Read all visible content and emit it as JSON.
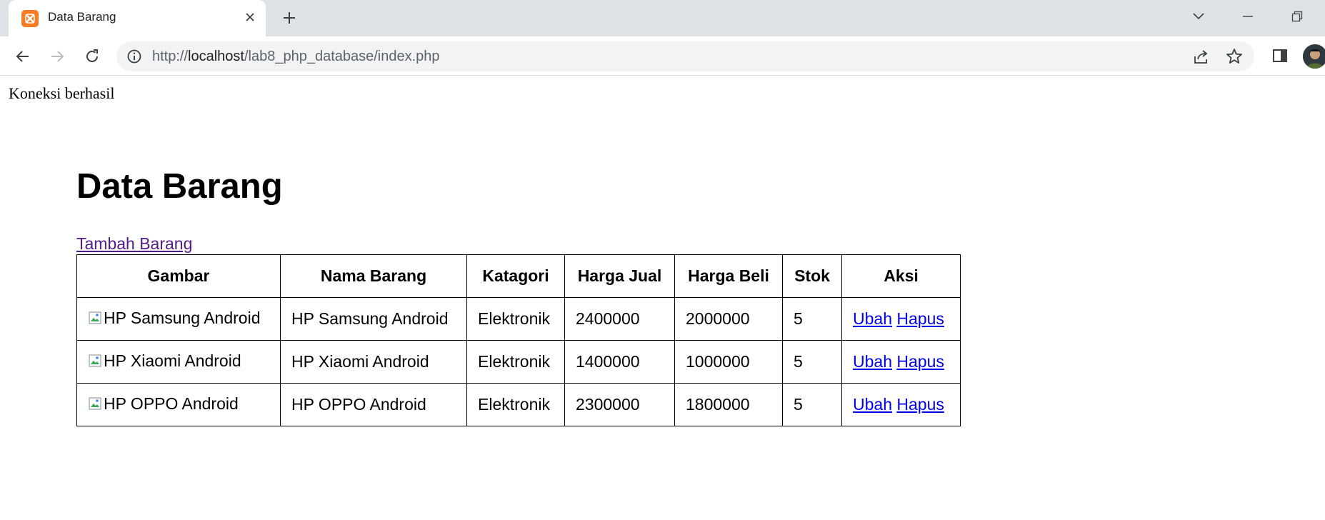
{
  "browser": {
    "tab_title": "Data Barang",
    "url_prefix": "http://",
    "url_host": "localhost",
    "url_path": "/lab8_php_database/index.php",
    "icons": {
      "favicon": "xampp-icon",
      "close": "close-icon",
      "new_tab": "plus-icon",
      "back": "arrow-left-icon",
      "forward": "arrow-right-icon",
      "reload": "reload-icon",
      "info": "info-icon",
      "share": "share-icon",
      "bookmark": "star-icon",
      "side_panel": "side-panel-icon"
    }
  },
  "page": {
    "status_message": "Koneksi berhasil",
    "title": "Data Barang",
    "add_link": "Tambah Barang",
    "table": {
      "headers": [
        "Gambar",
        "Nama Barang",
        "Katagori",
        "Harga Jual",
        "Harga Beli",
        "Stok",
        "Aksi"
      ],
      "rows": [
        {
          "gambar_alt": "HP Samsung Android",
          "nama": "HP Samsung Android",
          "kategori": "Elektronik",
          "harga_jual": "2400000",
          "harga_beli": "2000000",
          "stok": "5",
          "ubah": "Ubah",
          "hapus": "Hapus"
        },
        {
          "gambar_alt": "HP Xiaomi Android",
          "nama": "HP Xiaomi Android",
          "kategori": "Elektronik",
          "harga_jual": "1400000",
          "harga_beli": "1000000",
          "stok": "5",
          "ubah": "Ubah",
          "hapus": "Hapus"
        },
        {
          "gambar_alt": "HP OPPO Android",
          "nama": "HP OPPO Android",
          "kategori": "Elektronik",
          "harga_jual": "2300000",
          "harga_beli": "1800000",
          "stok": "5",
          "ubah": "Ubah",
          "hapus": "Hapus"
        }
      ]
    }
  },
  "colors": {
    "tabstrip": "#dee1e6",
    "omnibox": "#f1f3f4",
    "favicon": "#fb7a24",
    "visited_link": "#551a8b",
    "link": "#0000ee"
  }
}
